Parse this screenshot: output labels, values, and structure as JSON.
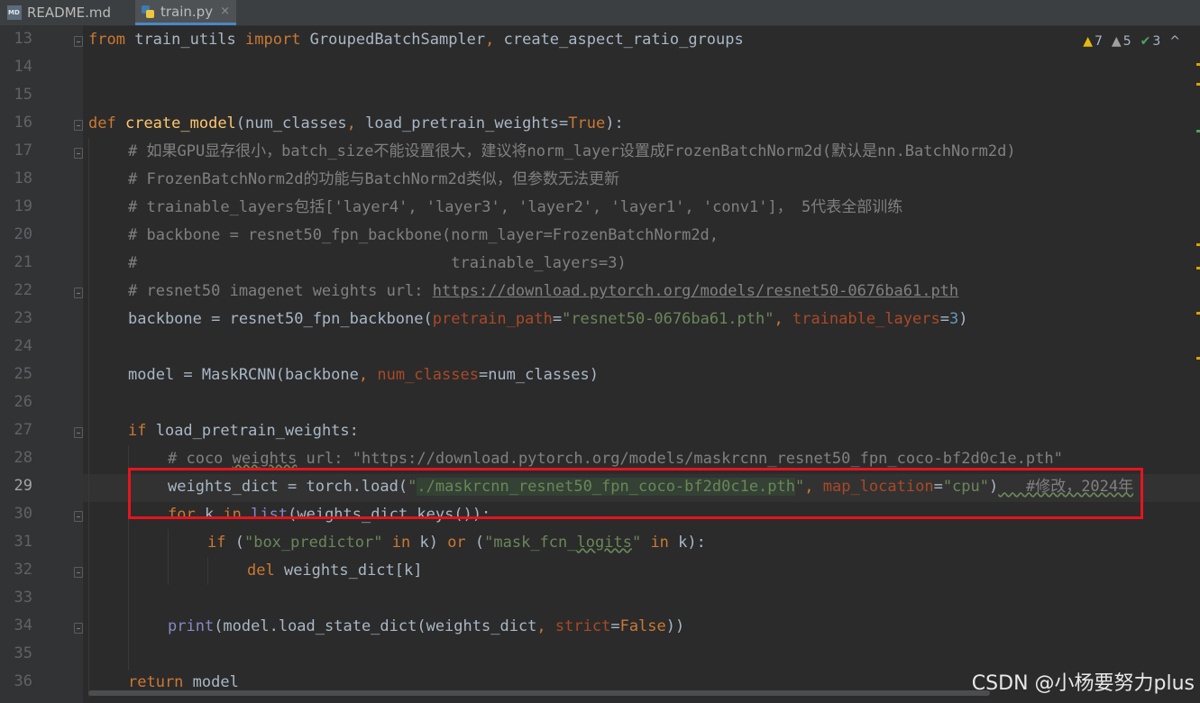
{
  "tabs": [
    {
      "label": "README.md",
      "icon": "markdown-file-icon",
      "active": false
    },
    {
      "label": "train.py",
      "icon": "python-file-icon",
      "active": true
    }
  ],
  "tab_close_glyph": "×",
  "inspections": {
    "warnings": "7",
    "weak_warnings": "5",
    "typos": "3",
    "nav_glyph": "^"
  },
  "line_numbers": [
    "13",
    "14",
    "15",
    "16",
    "17",
    "18",
    "19",
    "20",
    "21",
    "22",
    "23",
    "24",
    "25",
    "26",
    "27",
    "28",
    "29",
    "30",
    "31",
    "32",
    "33",
    "34",
    "35",
    "36"
  ],
  "current_line": "29",
  "code": {
    "l13": {
      "kw1": "from",
      "t1": " train_utils ",
      "kw2": "import",
      "t2": " GroupedBatchSampler",
      "sep": ", ",
      "t3": "create_aspect_ratio_groups"
    },
    "l16": {
      "kw": "def",
      "sp": " ",
      "fn": "create_model",
      "t1": "(num_classes",
      "sep": ", ",
      "t2": "load_pretrain_weights=",
      "val": "True",
      "t3": "):"
    },
    "l17": "# 如果GPU显存很小，batch_size不能设置很大，建议将norm_layer设置成FrozenBatchNorm2d(默认是nn.BatchNorm2d)",
    "l18": "# FrozenBatchNorm2d的功能与BatchNorm2d类似，但参数无法更新",
    "l19": "# trainable_layers包括['layer4', 'layer3', 'layer2', 'layer1', 'conv1']， 5代表全部训练",
    "l20": "# backbone = resnet50_fpn_backbone(norm_layer=FrozenBatchNorm2d,",
    "l21": "#                                  trainable_layers=3)",
    "l22": {
      "cm": "# resnet50 imagenet weights url: ",
      "url": "https://download.pytorch.org/models/resnet50-0676ba61.pth"
    },
    "l23": {
      "t1": "backbone = resnet50_fpn_backbone(",
      "p1": "pretrain_path",
      "eq1": "=",
      "s1": "\"resnet50-0676ba61.pth\"",
      "sep": ", ",
      "p2": "trainable_layers",
      "eq2": "=",
      "n": "3",
      "t2": ")"
    },
    "l25": {
      "t1": "model = MaskRCNN(backbone",
      "sep": ", ",
      "p": "num_classes",
      "t2": "=num_classes)"
    },
    "l27": {
      "kw": "if",
      "t": " load_pretrain_weights:"
    },
    "l28": {
      "a": "# coco ",
      "b": "weights",
      "c": " url: \"https://download.pytorch.org/models/maskrcnn_resnet50_fpn_coco-bf2d0c1e.pth\""
    },
    "l29": {
      "t1": "weights_dict = torch.load(",
      "q1": "\"",
      "s1": "./maskrcnn_resnet50_fpn_coco-bf2d0c1e.pth",
      "q2": "\"",
      "sep": ", ",
      "p": "map_location",
      "eq": "=",
      "s2": "\"cpu\"",
      "t2": ")",
      "cm": "   #修改，2024年"
    },
    "l30": {
      "kw1": "for",
      "t1": " k ",
      "kw2": "in",
      "sp": " ",
      "bi": "list",
      "t2": "(weights_dict.keys()):"
    },
    "l31": {
      "kw1": "if",
      "t1": " (",
      "s1": "\"box_predictor\"",
      "sp1": " ",
      "kw2": "in",
      "t2": " k) ",
      "kw3": "or",
      "t3": " (",
      "s2a": "\"mask_fcn_",
      "s2b": "logits",
      "s2c": "\"",
      "sp2": " ",
      "kw4": "in",
      "t4": " k):"
    },
    "l32": {
      "kw": "del",
      "t": " weights_dict[k]"
    },
    "l34": {
      "bi": "print",
      "t1": "(model.load_state_dict(weights_dict",
      "sep": ", ",
      "p": "strict",
      "eq": "=",
      "v": "False",
      "t2": "))"
    },
    "l36": {
      "kw": "return",
      "t": " model"
    }
  },
  "watermark": "CSDN @小杨要努力plus",
  "colors": {
    "background": "#2b2b2b",
    "gutter": "#313335",
    "keyword": "#cc7832",
    "string": "#6a8759",
    "comment": "#808080",
    "function": "#ffc66d",
    "parameter": "#aa4926",
    "number": "#6897bb",
    "annotation_box": "#e6141e"
  }
}
